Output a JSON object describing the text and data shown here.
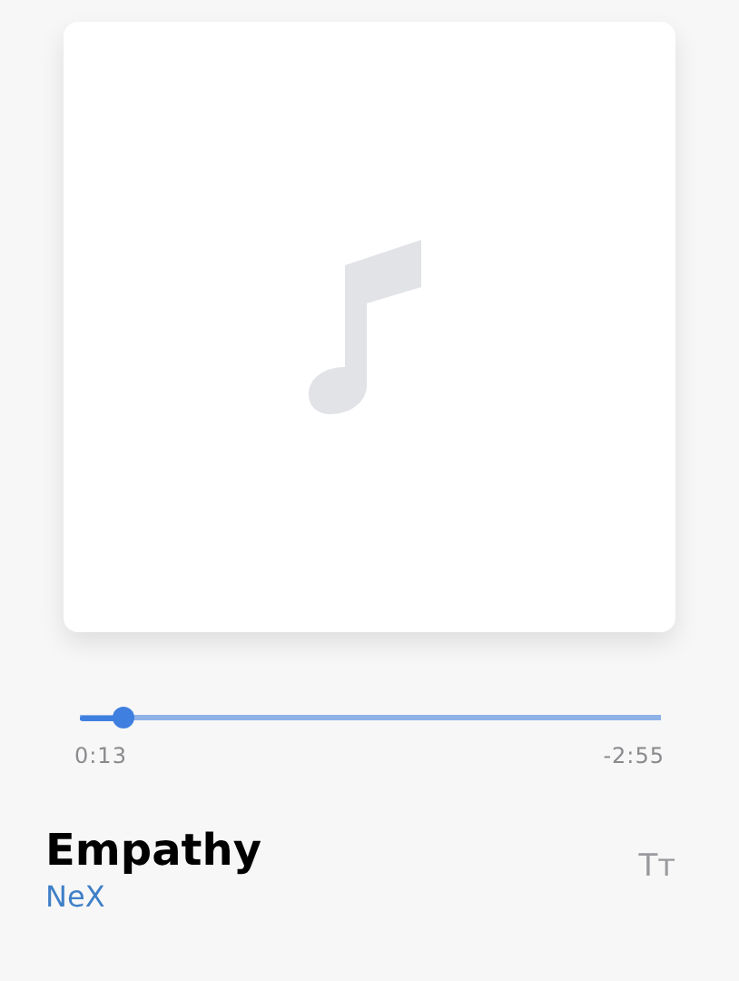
{
  "artwork": {
    "kind": "placeholder"
  },
  "progress": {
    "level": 0.075,
    "elapsed": "0:13",
    "remaining": "-2:55"
  },
  "track": {
    "title": "Empathy",
    "artist": "NeX",
    "text_button": "Tт"
  }
}
